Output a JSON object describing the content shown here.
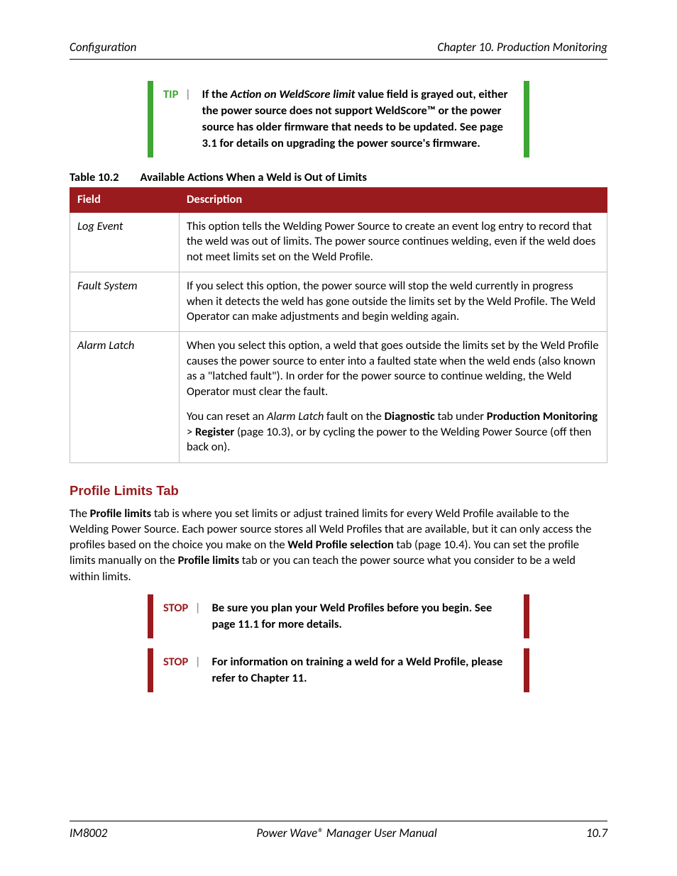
{
  "header": {
    "left": "Configuration",
    "right": "Chapter 10. Production Monitoring"
  },
  "tip": {
    "label": "TIP",
    "pipe": "|",
    "text_pre": "If the ",
    "text_em": "Action on WeldScore limit",
    "text_post": " value field is grayed out, either the power source does not support WeldScore™ or the power source has older firmware that needs to be updated.  See page 3.1 for details on upgrading the power source's firmware."
  },
  "table": {
    "caption_num": "Table 10.2",
    "caption_title": "Available Actions When a Weld is Out of Limits",
    "head_field": "Field",
    "head_desc": "Description",
    "rows": [
      {
        "field": "Log Event",
        "desc": "This option tells the Welding Power Source to create an event log entry to record that the weld was out of limits.  The power source continues welding, even if the weld does not meet limits set on the Weld Profile."
      },
      {
        "field": "Fault System",
        "desc": "If you select this option, the power source will stop the weld currently in progress when it detects the weld has gone outside the limits set by the Weld Profile.  The Weld Operator can make adjustments and begin welding again."
      },
      {
        "field": "Alarm Latch",
        "desc": "When you select this option, a weld that goes outside the limits set by the Weld Profile causes the power source to enter into a faulted state when the weld ends (also known as a \"latched fault\").  In order for the power source to continue welding, the Weld Operator must clear the fault.",
        "desc2_a": "You can reset an ",
        "desc2_b": "Alarm Latch",
        "desc2_c": " fault on the ",
        "desc2_d": "Diagnostic",
        "desc2_e": " tab under ",
        "desc2_f": "Production Monitoring",
        "desc2_g": " > ",
        "desc2_h": "Register",
        "desc2_i": " (page 10.3), or by cycling the power to the Welding Power Source (off then back on)."
      }
    ]
  },
  "section": {
    "heading": "Profile Limits Tab",
    "p1_a": "The ",
    "p1_b": "Profile limits",
    "p1_c": " tab is where you set limits or adjust trained limits for every Weld Profile available to the Welding Power Source.  Each power source stores all Weld Profiles that are available, but it can only access the profiles based on the choice you make on the ",
    "p1_d": "Weld Profile selection",
    "p1_e": " tab (page 10.4).  You can set the profile limits manually on the ",
    "p1_f": "Profile limits",
    "p1_g": " tab or you can teach the power source what you consider to be a weld within limits."
  },
  "stops": [
    {
      "label": "STOP",
      "pipe": "|",
      "text": "Be sure you plan your Weld Profiles before you begin.  See page 11.1 for more details."
    },
    {
      "label": "STOP",
      "pipe": "|",
      "text": "For information on training a weld for a Weld Profile, please refer to Chapter 11."
    }
  ],
  "footer": {
    "left": "IM8002",
    "center": "Power Wave® Manager User Manual",
    "right": "10.7"
  }
}
